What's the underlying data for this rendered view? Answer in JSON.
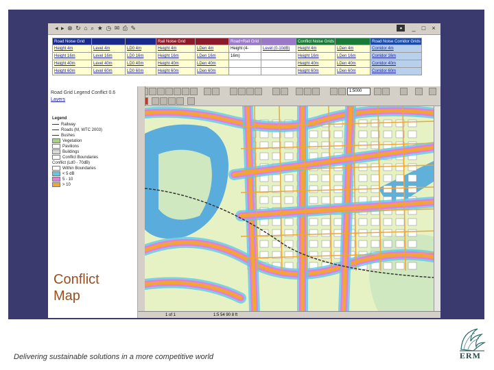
{
  "caption": {
    "line1": "Conflict",
    "line2": "Map"
  },
  "footer": {
    "tagline": "Delivering sustainable solutions in a more competitive world"
  },
  "logo": {
    "text": "ERM"
  },
  "sidebar": {
    "title": "Road Grid Legend Conflict 0.6",
    "layers_link": "Layers"
  },
  "legend": {
    "title": "Legend",
    "items": [
      {
        "label": "Railway",
        "swatch": "line"
      },
      {
        "label": "Roads (M, WTC 2003)",
        "swatch": "line"
      },
      {
        "label": "Bushes",
        "swatch": "line"
      },
      {
        "label": "Vegetation",
        "swatch": "#a6d67a"
      },
      {
        "label": "Pavilions",
        "swatch": "#ffffff"
      },
      {
        "label": "Buildings",
        "swatch": "#d9d9d9"
      },
      {
        "label": "Conflict Boundaries",
        "swatch": "#ffffff"
      },
      {
        "label": "Conflict (Ld0 - 70dB)",
        "swatch": "none"
      },
      {
        "label": "Within Boundaries",
        "swatch": "#ffffff"
      },
      {
        "label": "< 5 dB",
        "swatch": "#5fc8e6"
      },
      {
        "label": "5 - 10",
        "swatch": "#e77be6"
      },
      {
        "label": "> 10",
        "swatch": "#f0a534"
      }
    ]
  },
  "info_table": {
    "headers": [
      {
        "label": "Road Noise Grid",
        "color": "#1a2a8a"
      },
      {
        "label": "",
        "color": "#1a2a8a"
      },
      {
        "label": "",
        "color": "#1a2a8a"
      },
      {
        "label": "Rail Noise Grid",
        "color": "#8b1a2a"
      },
      {
        "label": "",
        "color": "#8b1a2a"
      },
      {
        "label": "Road+Rail Grid",
        "color": "#9a7ac8"
      },
      {
        "label": "",
        "color": "#9a7ac8"
      },
      {
        "label": "Conflict Noise Grids",
        "color": "#1a7a3a"
      },
      {
        "label": "",
        "color": "#1a7a3a"
      },
      {
        "label": "Road Noise Corridor Grids",
        "color": "#1a4aa8"
      }
    ],
    "rows": [
      [
        "Height 4m",
        "Level 4m",
        "LD0 4m",
        "Height 4m",
        "LDen 4m",
        "Height (4-",
        "Level (0-10dB)",
        "Height 4m",
        "LDen 4m",
        "Corridor 4m"
      ],
      [
        "Height 16m",
        "Level 16m",
        "LD0 16m",
        "Height 16m",
        "LDen 16m",
        "16m)",
        "",
        "Height 16m",
        "LDen 16m",
        "Corridor 16m"
      ],
      [
        "Height 40m",
        "Level 40m",
        "LD0 40m",
        "Height 40m",
        "LDen 40m",
        "",
        "",
        "Height 40m",
        "LDen 40m",
        "Corridor 40m"
      ],
      [
        "Height 60m",
        "Level 60m",
        "LD0 60m",
        "Height 60m",
        "LDen 60m",
        "",
        "",
        "Height 60m",
        "LDen 60m",
        "Corridor 60m"
      ]
    ]
  },
  "map_toolbar": {
    "zoom": "1:5000"
  },
  "statusbar": {
    "page": "1 of 1",
    "coord": "1:5 54 90 8 ft"
  },
  "colors": {
    "frame": "#3a3a6e",
    "land": "#e6f2c4",
    "road": "#f0a534",
    "pink": "#e77be6",
    "blue": "#5fc8e6",
    "water": "#3fa0df",
    "caption": "#9b4d1e"
  }
}
